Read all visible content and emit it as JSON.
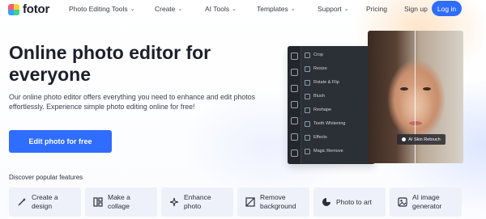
{
  "brand": {
    "name": "fotor"
  },
  "nav": {
    "items": [
      {
        "label": "Photo Editing Tools",
        "dropdown": true
      },
      {
        "label": "Create",
        "dropdown": true
      },
      {
        "label": "AI Tools",
        "dropdown": true
      },
      {
        "label": "Templates",
        "dropdown": true
      },
      {
        "label": "Support",
        "dropdown": true
      },
      {
        "label": "Pricing",
        "dropdown": false
      },
      {
        "label": "Sign up",
        "dropdown": false
      }
    ],
    "login_label": "Log in"
  },
  "hero": {
    "title_line1": "Online photo editor for",
    "title_line2": "everyone",
    "description": "Our online photo editor offers everything you need to enhance and edit photos effortlessly. Experience simple photo editing online for free!",
    "cta_label": "Edit photo for free"
  },
  "editor_preview": {
    "menu": [
      "Crop",
      "Resize",
      "Rotate & Flip",
      "Blush",
      "Reshape",
      "Teeth Whitening",
      "Effects",
      "Magic Remove"
    ],
    "badge_label": "AI Skin Retouch"
  },
  "features": {
    "heading": "Discover popular features",
    "cards": [
      {
        "label": "Create a\ndesign",
        "icon": "magic-wand-icon"
      },
      {
        "label": "Make a\ncollage",
        "icon": "collage-icon"
      },
      {
        "label": "Enhance\nphoto",
        "icon": "sparkle-icon"
      },
      {
        "label": "Remove\nbackground",
        "icon": "remove-bg-icon"
      },
      {
        "label": "Photo to art",
        "icon": "art-icon"
      },
      {
        "label": "AI image\ngenerator",
        "icon": "ai-image-icon"
      }
    ]
  },
  "colors": {
    "accent": "#2f6dff",
    "card_bg": "#eef1f9",
    "text": "#1d1f2a"
  }
}
